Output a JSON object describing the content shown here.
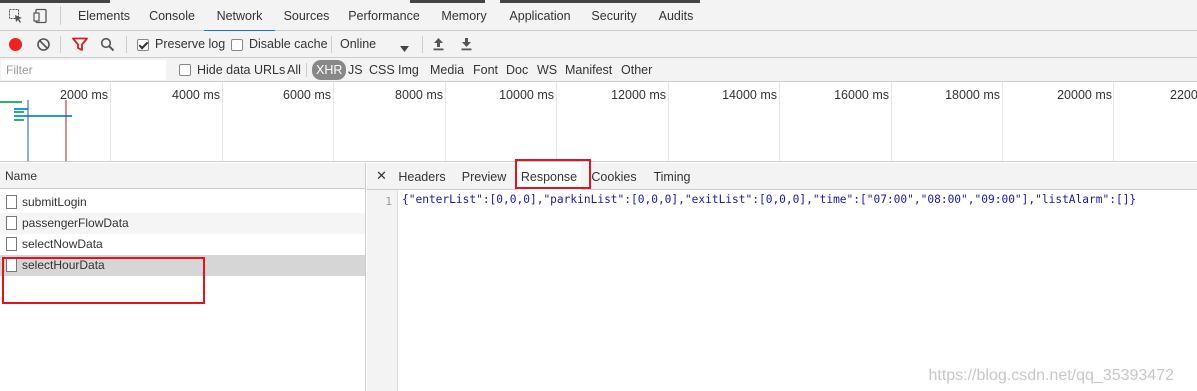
{
  "devtools": {
    "tabs": [
      "Elements",
      "Console",
      "Network",
      "Sources",
      "Performance",
      "Memory",
      "Application",
      "Security",
      "Audits"
    ],
    "active_tab": "Network"
  },
  "toolbar": {
    "preserve_log_label": "Preserve log",
    "preserve_log_checked": true,
    "disable_cache_label": "Disable cache",
    "disable_cache_checked": false,
    "throttle_value": "Online"
  },
  "filter": {
    "placeholder": "Filter",
    "hide_data_urls_label": "Hide data URLs",
    "hide_data_urls_checked": false,
    "types": [
      "All",
      "XHR",
      "JS",
      "CSS",
      "Img",
      "Media",
      "Font",
      "Doc",
      "WS",
      "Manifest",
      "Other"
    ],
    "selected_type": "XHR"
  },
  "timeline": {
    "ticks": [
      "2000 ms",
      "4000 ms",
      "6000 ms",
      "8000 ms",
      "10000 ms",
      "12000 ms",
      "14000 ms",
      "16000 ms",
      "18000 ms",
      "20000 ms",
      "2200"
    ]
  },
  "requests": {
    "header": "Name",
    "items": [
      "submitLogin",
      "passengerFlowData",
      "selectNowData",
      "selectHourData"
    ],
    "selected": "selectHourData"
  },
  "detail": {
    "tabs": [
      "Headers",
      "Preview",
      "Response",
      "Cookies",
      "Timing"
    ],
    "active_tab": "Response",
    "line_number": "1",
    "response_body": "{\"enterList\":[0,0,0],\"parkinList\":[0,0,0],\"exitList\":[0,0,0],\"time\":[\"07:00\",\"08:00\",\"09:00\"],\"listAlarm\":[]}"
  },
  "watermark": "https://blog.csdn.net/qq_35393472",
  "colors": {
    "annotation": "#e0141e",
    "record": "#ee2222",
    "filter_icon": "#d02020",
    "active_tab_underline": "#1a73e8"
  }
}
